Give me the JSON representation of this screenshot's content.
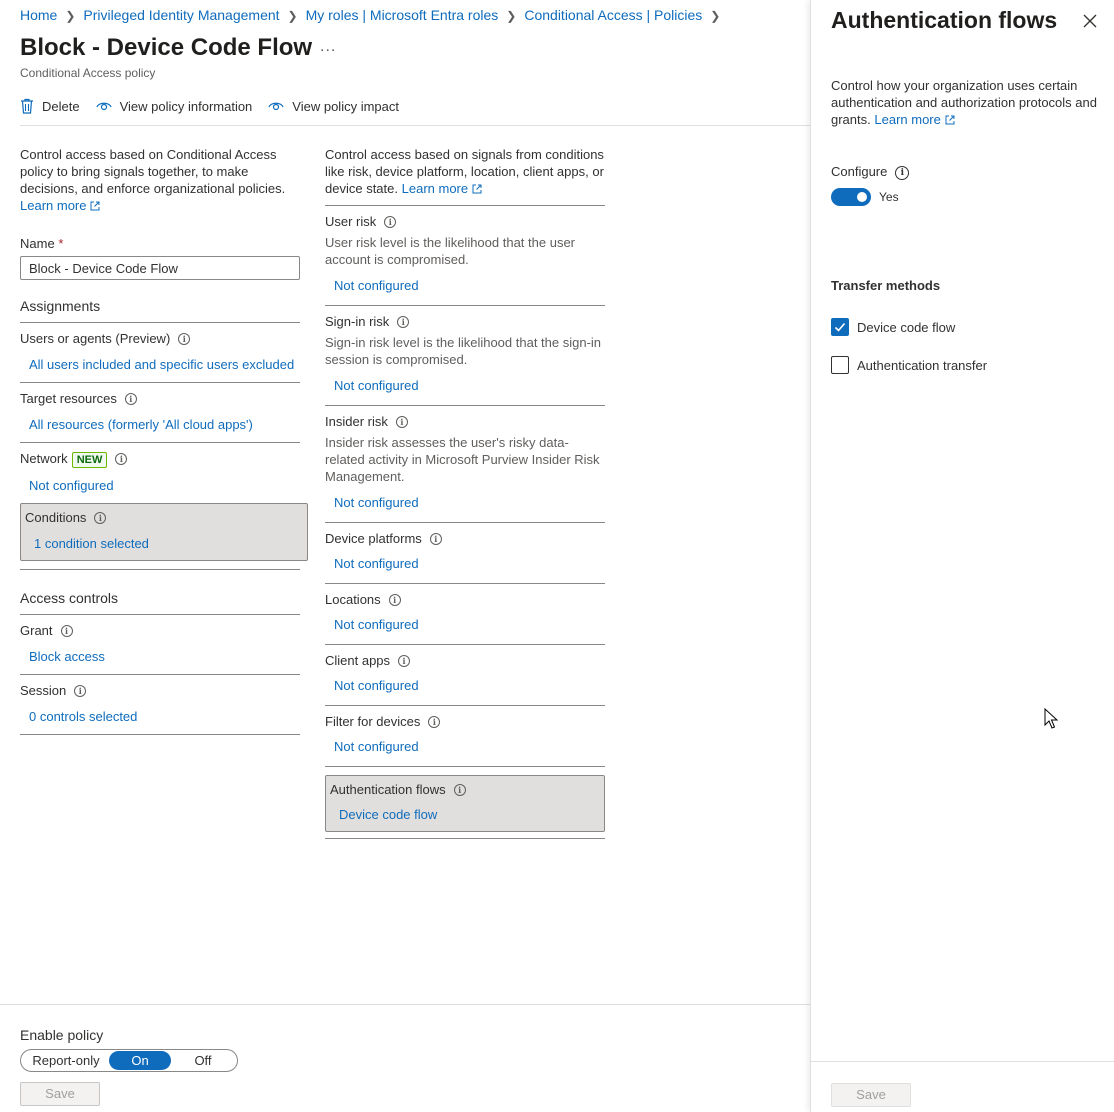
{
  "breadcrumb": [
    "Home",
    "Privileged Identity Management",
    "My roles | Microsoft Entra roles",
    "Conditional Access | Policies"
  ],
  "page": {
    "title": "Block - Device Code Flow",
    "more": "...",
    "subtitle": "Conditional Access policy"
  },
  "toolbar": {
    "delete": "Delete",
    "view_info": "View policy information",
    "view_impact": "View policy impact"
  },
  "left": {
    "intro": "Control access based on Conditional Access policy to bring signals together, to make decisions, and enforce organizational policies.",
    "learn_more": "Learn more",
    "name_label": "Name",
    "name_required": "*",
    "name_value": "Block - Device Code Flow",
    "assignments_head": "Assignments",
    "users_label": "Users or agents (Preview)",
    "users_value": "All users included and specific users excluded",
    "target_label": "Target resources",
    "target_value": "All resources (formerly 'All cloud apps')",
    "network_label": "Network",
    "network_badge": "NEW",
    "network_value": "Not configured",
    "conditions_label": "Conditions",
    "conditions_value": "1 condition selected",
    "access_head": "Access controls",
    "grant_label": "Grant",
    "grant_value": "Block access",
    "session_label": "Session",
    "session_value": "0 controls selected"
  },
  "middle": {
    "intro": "Control access based on signals from conditions like risk, device platform, location, client apps, or device state.",
    "learn_more": "Learn more",
    "items": [
      {
        "label": "User risk",
        "desc": "User risk level is the likelihood that the user account is compromised.",
        "value": "Not configured"
      },
      {
        "label": "Sign-in risk",
        "desc": "Sign-in risk level is the likelihood that the sign-in session is compromised.",
        "value": "Not configured"
      },
      {
        "label": "Insider risk",
        "desc": "Insider risk assesses the user's risky data-related activity in Microsoft Purview Insider Risk Management.",
        "value": "Not configured"
      },
      {
        "label": "Device platforms",
        "desc": "",
        "value": "Not configured"
      },
      {
        "label": "Locations",
        "desc": "",
        "value": "Not configured"
      },
      {
        "label": "Client apps",
        "desc": "",
        "value": "Not configured"
      },
      {
        "label": "Filter for devices",
        "desc": "",
        "value": "Not configured"
      },
      {
        "label": "Authentication flows",
        "desc": "",
        "value": "Device code flow"
      }
    ]
  },
  "enable": {
    "label": "Enable policy",
    "options": [
      "Report-only",
      "On",
      "Off"
    ],
    "selected": "On",
    "save": "Save"
  },
  "panel": {
    "title": "Authentication flows",
    "desc": "Control how your organization uses certain authentication and authorization protocols and grants.",
    "learn_more": "Learn more",
    "configure_label": "Configure",
    "toggle_text": "Yes",
    "transfer_head": "Transfer methods",
    "methods": [
      {
        "label": "Device code flow",
        "checked": true
      },
      {
        "label": "Authentication transfer",
        "checked": false
      }
    ],
    "save": "Save"
  },
  "colors": {
    "accent": "#0f6cbd",
    "selected_bg": "#e1dfdd"
  }
}
